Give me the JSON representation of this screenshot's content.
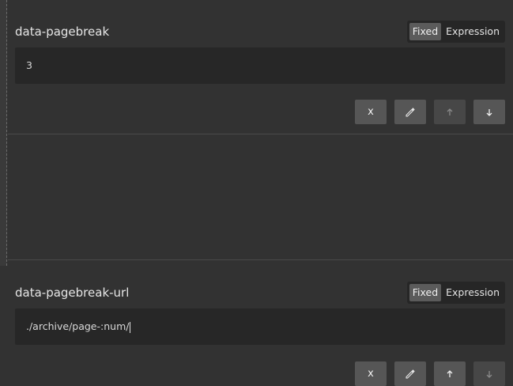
{
  "fields": [
    {
      "label": "data-pagebreak",
      "mode_options": [
        "Fixed",
        "Expression"
      ],
      "active_mode": "Fixed",
      "value": "3",
      "buttons": [
        {
          "name": "remove",
          "label": "x",
          "enabled": true
        },
        {
          "name": "edit",
          "icon": "pencil-icon",
          "enabled": true
        },
        {
          "name": "move-up",
          "icon": "arrow-up-icon",
          "enabled": false
        },
        {
          "name": "move-down",
          "icon": "arrow-down-icon",
          "enabled": true
        }
      ]
    },
    {
      "label": "data-pagebreak-url",
      "mode_options": [
        "Fixed",
        "Expression"
      ],
      "active_mode": "Fixed",
      "value": "./archive/page-:num/",
      "buttons": [
        {
          "name": "remove",
          "label": "x",
          "enabled": true
        },
        {
          "name": "edit",
          "icon": "pencil-icon",
          "enabled": true
        },
        {
          "name": "move-up",
          "icon": "arrow-up-icon",
          "enabled": true
        },
        {
          "name": "move-down",
          "icon": "arrow-down-icon",
          "enabled": false
        }
      ]
    }
  ],
  "colors": {
    "background": "#323232",
    "input_bg": "#272727",
    "button_bg": "#565656",
    "active_toggle": "#5b5b5b"
  }
}
